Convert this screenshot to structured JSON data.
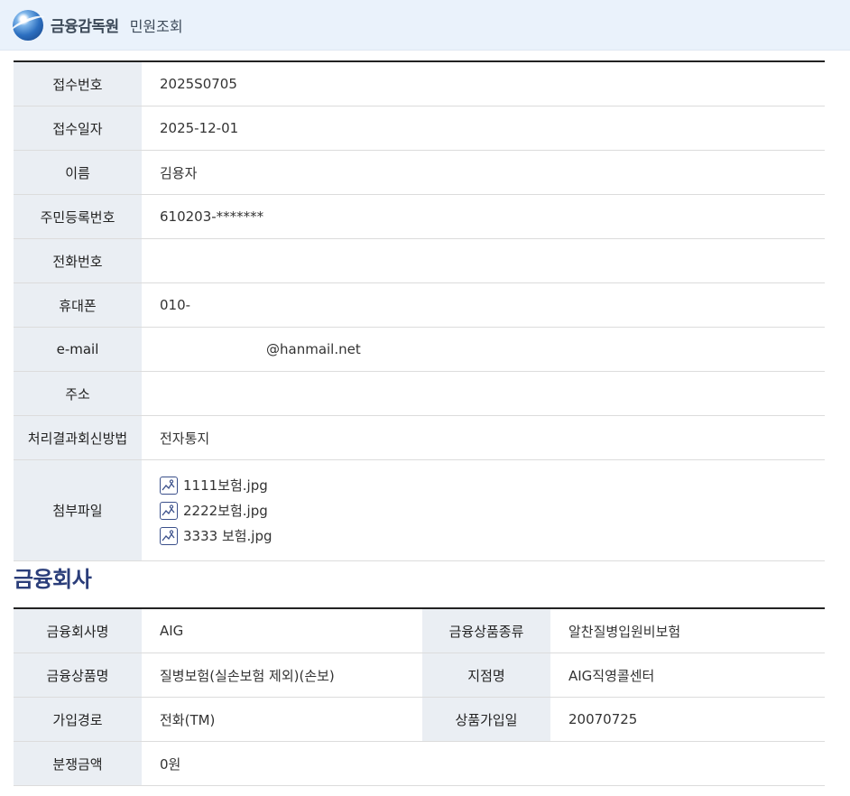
{
  "header": {
    "brand": "금융감독원",
    "page_name": "민원조회"
  },
  "complaint": {
    "rows": [
      {
        "label": "접수번호",
        "value": "2025S0705"
      },
      {
        "label": "접수일자",
        "value": "2025-12-01"
      },
      {
        "label": "이름",
        "value": "김용자"
      },
      {
        "label": "주민등록번호",
        "value": "610203-*******"
      },
      {
        "label": "전화번호",
        "value": ""
      },
      {
        "label": "휴대폰",
        "value": "010-"
      },
      {
        "label": "e-mail",
        "value": "@hanmail.net"
      },
      {
        "label": "주소",
        "value": ""
      },
      {
        "label": "처리결과회신방법",
        "value": "전자통지"
      }
    ],
    "attachments_label": "첨부파일",
    "attachments": [
      "1111보험.jpg",
      "2222보험.jpg",
      "3333 보험.jpg"
    ]
  },
  "company_section": {
    "title": "금융회사",
    "rows": [
      {
        "l1": "금융회사명",
        "v1": "AIG",
        "l2": "금융상품종류",
        "v2": "알찬질병입원비보험"
      },
      {
        "l1": "금융상품명",
        "v1": "질병보험(실손보험 제외)(손보)",
        "l2": "지점명",
        "v2": "AIG직영콜센터"
      },
      {
        "l1": "가입경로",
        "v1": "전화(TM)",
        "l2": "상품가입일",
        "v2": "20070725"
      },
      {
        "l1": "분쟁금액",
        "v1": "0원"
      }
    ]
  },
  "icons": {
    "logo": "fss-globe-logo",
    "attachment": "image-file-icon"
  }
}
